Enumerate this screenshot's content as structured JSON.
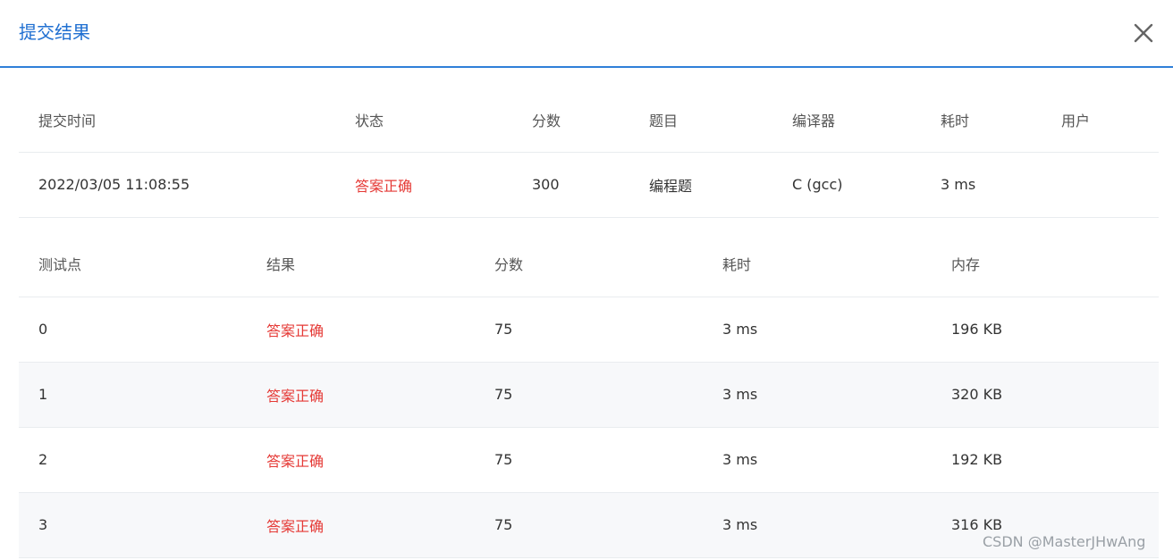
{
  "dialog": {
    "title": "提交结果"
  },
  "icons": {
    "close": "close-icon"
  },
  "colors": {
    "accent": "#2f7fd8",
    "title": "#1f6fd1",
    "status_ok": "#e53935"
  },
  "summary": {
    "headers": [
      "提交时间",
      "状态",
      "分数",
      "题目",
      "编译器",
      "耗时",
      "用户"
    ],
    "row": {
      "time": "2022/03/05 11:08:55",
      "status": "答案正确",
      "score": "300",
      "problem": "编程题",
      "compiler": "C (gcc)",
      "duration": "3 ms",
      "user": ""
    }
  },
  "cases": {
    "headers": [
      "测试点",
      "结果",
      "分数",
      "耗时",
      "内存"
    ],
    "rows": [
      {
        "id": "0",
        "result": "答案正确",
        "score": "75",
        "time": "3 ms",
        "memory": "196 KB"
      },
      {
        "id": "1",
        "result": "答案正确",
        "score": "75",
        "time": "3 ms",
        "memory": "320 KB"
      },
      {
        "id": "2",
        "result": "答案正确",
        "score": "75",
        "time": "3 ms",
        "memory": "192 KB"
      },
      {
        "id": "3",
        "result": "答案正确",
        "score": "75",
        "time": "3 ms",
        "memory": "316 KB"
      }
    ]
  },
  "watermark": "CSDN @MasterJHwAng"
}
